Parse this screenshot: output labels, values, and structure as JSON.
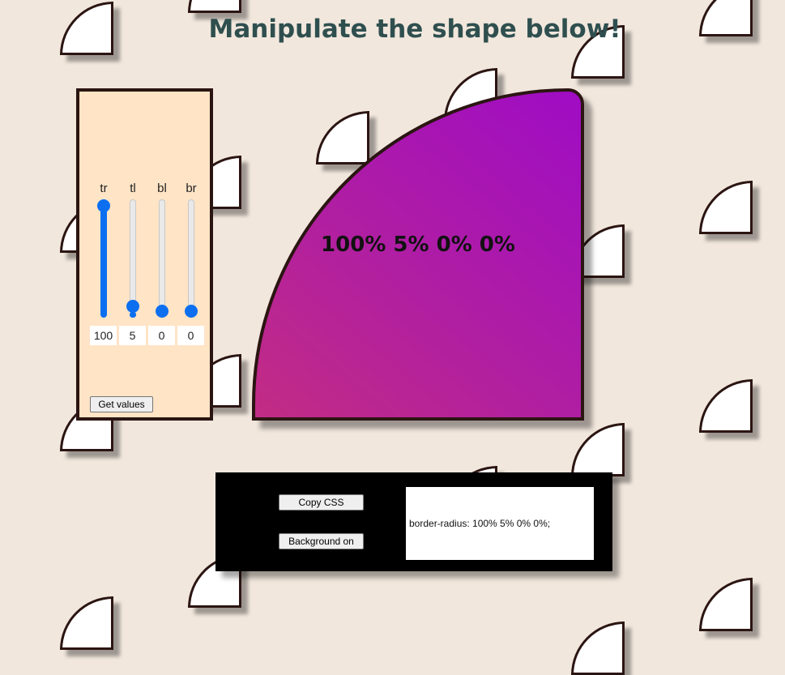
{
  "title": "Manipulate the shape below!",
  "shape": {
    "label": "100% 5% 0% 0%",
    "gradient_colors": [
      "#9f0cc4",
      "#c22c84"
    ],
    "border_color": "#2b1512"
  },
  "sliders": [
    {
      "label": "tr",
      "value": 100
    },
    {
      "label": "tl",
      "value": 5
    },
    {
      "label": "bl",
      "value": 0
    },
    {
      "label": "br",
      "value": 0
    }
  ],
  "controls": {
    "get_values_label": "Get values"
  },
  "output": {
    "copy_css_label": "Copy CSS",
    "background_label": "Background on",
    "css_text": "border-radius: 100% 5% 0% 0%;"
  },
  "colors": {
    "page_background": "#f1e7dd",
    "panel_background": "#ffe4c6",
    "accent": "#0b6ff0",
    "title": "#2f4f4f"
  }
}
